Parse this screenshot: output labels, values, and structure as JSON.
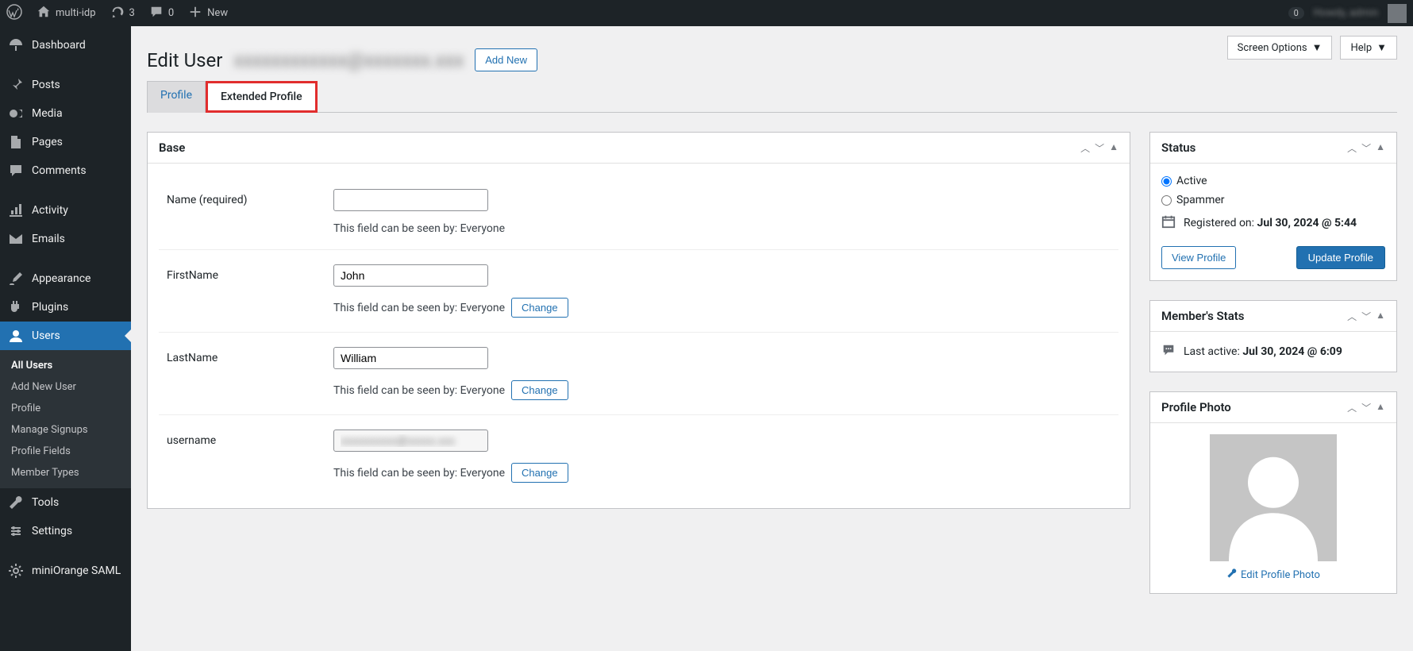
{
  "toolbar": {
    "site_name": "multi-idp",
    "updates_count": "3",
    "comments_count": "0",
    "new_label": "New",
    "notif_count": "0",
    "greeting": "Howdy, admin"
  },
  "sidebar": {
    "dashboard": "Dashboard",
    "posts": "Posts",
    "media": "Media",
    "pages": "Pages",
    "comments": "Comments",
    "activity": "Activity",
    "emails": "Emails",
    "appearance": "Appearance",
    "plugins": "Plugins",
    "users": "Users",
    "tools": "Tools",
    "settings": "Settings",
    "miniorange": "miniOrange SAML",
    "sub": {
      "all_users": "All Users",
      "add_new": "Add New User",
      "profile": "Profile",
      "manage_signups": "Manage Signups",
      "profile_fields": "Profile Fields",
      "member_types": "Member Types"
    }
  },
  "top_tabs": {
    "screen_options": "Screen Options",
    "help": "Help"
  },
  "page": {
    "title": "Edit User",
    "username_blurred": "xxxxxxxxxxxx@xxxxxxx.xxx",
    "add_new": "Add New"
  },
  "tabs": {
    "profile": "Profile",
    "extended": "Extended Profile"
  },
  "base_panel": {
    "title": "Base",
    "fields": {
      "name": {
        "label": "Name (required)",
        "value": "",
        "hint": "This field can be seen by: Everyone"
      },
      "firstname": {
        "label": "FirstName",
        "value": "John",
        "hint": "This field can be seen by: Everyone",
        "change": "Change"
      },
      "lastname": {
        "label": "LastName",
        "value": "William",
        "hint": "This field can be seen by: Everyone",
        "change": "Change"
      },
      "username": {
        "label": "username",
        "value": "xxxxxxxxxx@xxxxx.xxx",
        "hint": "This field can be seen by: Everyone",
        "change": "Change"
      }
    }
  },
  "status_panel": {
    "title": "Status",
    "active": "Active",
    "spammer": "Spammer",
    "registered_label": "Registered on:",
    "registered_value": "Jul 30, 2024 @ 5:44",
    "view_profile": "View Profile",
    "update_profile": "Update Profile"
  },
  "stats_panel": {
    "title": "Member's Stats",
    "last_active_label": "Last active:",
    "last_active_value": "Jul 30, 2024 @ 6:09"
  },
  "photo_panel": {
    "title": "Profile Photo",
    "edit": "Edit Profile Photo"
  }
}
